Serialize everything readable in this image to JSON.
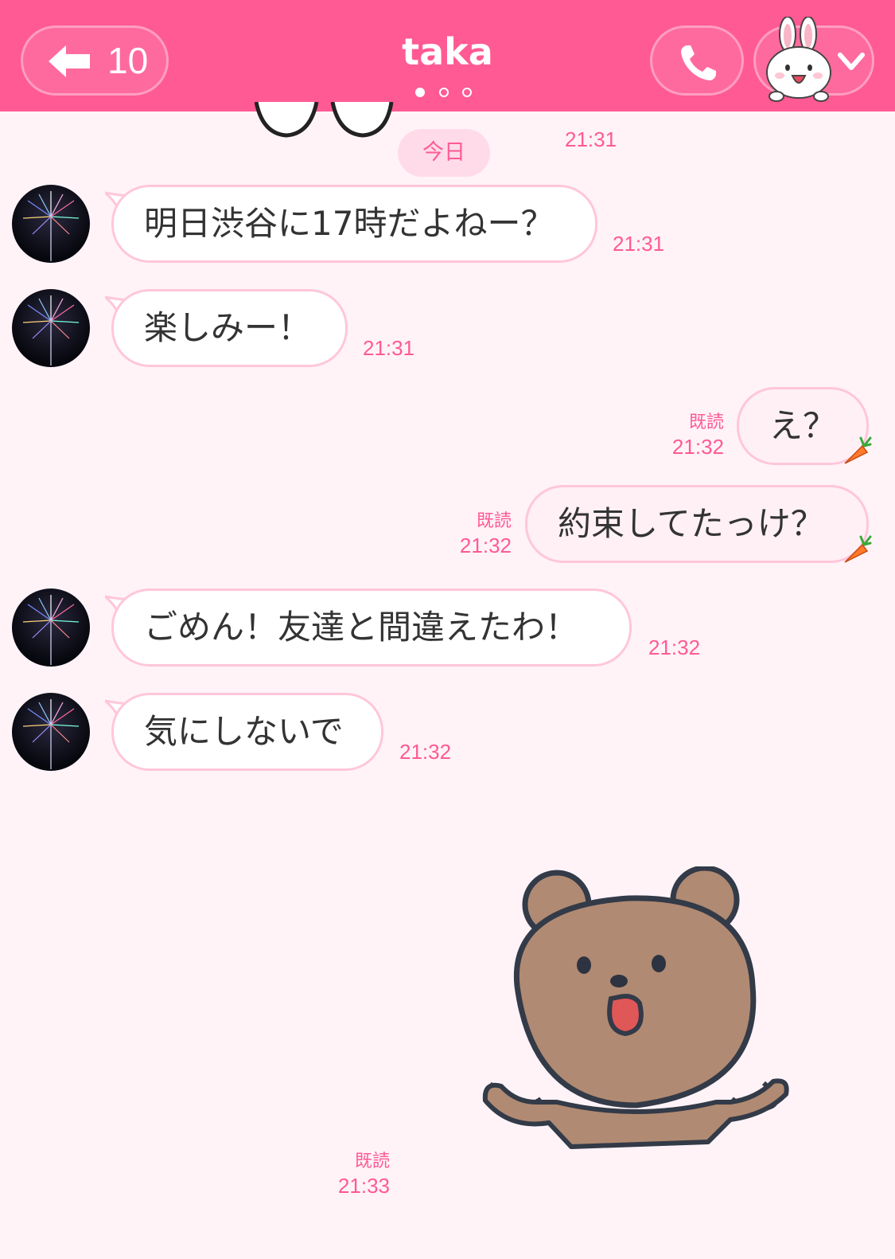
{
  "header": {
    "back_count": "10",
    "title": "taka",
    "page_indicator": {
      "total": 3,
      "active": 0
    }
  },
  "chat": {
    "date_label": "今日",
    "top_sticker_time": "21:31",
    "read_label": "既読",
    "messages": [
      {
        "side": "in",
        "text": "明日渋谷に17時だよねー？",
        "time": "21:31"
      },
      {
        "side": "in",
        "text": "楽しみー！",
        "time": "21:31"
      },
      {
        "side": "out",
        "text": "え？",
        "time": "21:32",
        "read": "既読"
      },
      {
        "side": "out",
        "text": "約束してたっけ？",
        "time": "21:32",
        "read": "既読"
      },
      {
        "side": "in",
        "text": "ごめん！友達と間違えたわ！",
        "time": "21:32"
      },
      {
        "side": "in",
        "text": "気にしないで",
        "time": "21:32"
      }
    ],
    "sticker_message": {
      "read": "既読",
      "time": "21:33",
      "icon": "bear-shrug-sticker"
    }
  },
  "colors": {
    "header": "#ff5a93",
    "accent": "#ff5a93",
    "background": "#fff3f8",
    "bubble_border": "#ffc6da"
  }
}
